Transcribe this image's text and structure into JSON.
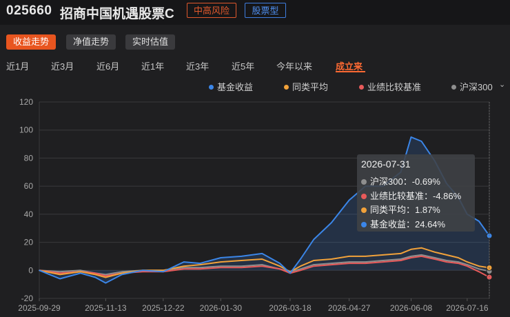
{
  "fund": {
    "code": "025660",
    "name": "招商中国机遇股票C",
    "risk_tag": "中高风险",
    "type_tag": "股票型"
  },
  "view_buttons": [
    "收益走势",
    "净值走势",
    "实时估值"
  ],
  "ranges": [
    "近1月",
    "近3月",
    "近6月",
    "近1年",
    "近3年",
    "近5年",
    "今年以来",
    "成立来"
  ],
  "active_range": "成立来",
  "colors": {
    "fund": "#3b86e8",
    "peer": "#f2a23a",
    "benchmark": "#e85a5a",
    "hs300": "#8e8e8e",
    "accent": "#e8551f"
  },
  "tooltip": {
    "date": "2026-07-31",
    "rows": [
      {
        "label": "沪深300：-0.69%",
        "series": "hs300"
      },
      {
        "label": "业绩比较基准：-4.86%",
        "series": "benchmark"
      },
      {
        "label": "同类平均：1.87%",
        "series": "peer"
      },
      {
        "label": "基金收益：24.64%",
        "series": "fund"
      }
    ]
  },
  "chart_data": {
    "type": "line",
    "ylim": [
      -20,
      120
    ],
    "y_ticks": [
      "120",
      "100",
      "80",
      "60",
      "40",
      "20",
      "0",
      "-20"
    ],
    "x_tick_labels": [
      "2025-09-29",
      "2025-11-13",
      "2025-12-22",
      "2026-01-30",
      "2026-03-18",
      "2026-04-27",
      "2026-06-08",
      "2026-07-16"
    ],
    "x": [
      "2025-09-29",
      "2025-10-13",
      "2025-10-27",
      "2025-11-06",
      "2025-11-13",
      "2025-11-24",
      "2025-12-08",
      "2025-12-22",
      "2026-01-05",
      "2026-01-16",
      "2026-01-30",
      "2026-02-13",
      "2026-02-27",
      "2026-03-11",
      "2026-03-18",
      "2026-03-25",
      "2026-04-03",
      "2026-04-15",
      "2026-04-27",
      "2026-05-08",
      "2026-05-20",
      "2026-06-01",
      "2026-06-08",
      "2026-06-15",
      "2026-06-24",
      "2026-07-02",
      "2026-07-10",
      "2026-07-16",
      "2026-07-24",
      "2026-07-31"
    ],
    "series": [
      {
        "name": "基金收益",
        "key": "fund",
        "values": [
          0,
          -6,
          -2,
          -5,
          -9,
          -3,
          0,
          -1,
          6,
          5,
          9,
          10,
          12,
          5,
          -2,
          8,
          22,
          34,
          50,
          60,
          60,
          70,
          95,
          92,
          78,
          62,
          52,
          40,
          35,
          24.64
        ]
      },
      {
        "name": "同类平均",
        "key": "peer",
        "values": [
          0,
          -3,
          -1,
          -3,
          -5,
          -2,
          0,
          0,
          3,
          4,
          6,
          7,
          8,
          3,
          -1,
          3,
          7,
          8,
          10,
          10,
          11,
          12,
          15,
          16,
          13,
          11,
          9,
          6,
          3,
          1.87
        ]
      },
      {
        "name": "业绩比较基准",
        "key": "benchmark",
        "values": [
          0,
          -2,
          -1,
          -2,
          -4,
          -2,
          -1,
          -1,
          1,
          1,
          2,
          2,
          3,
          1,
          -2,
          0,
          3,
          4,
          5,
          5,
          6,
          7,
          9,
          10,
          8,
          6,
          5,
          3,
          -1,
          -4.86
        ]
      },
      {
        "name": "沪深300",
        "key": "hs300",
        "values": [
          0,
          -1,
          0,
          -2,
          -3,
          -1,
          0,
          0,
          2,
          2,
          3,
          3,
          4,
          1,
          -1,
          1,
          4,
          5,
          6,
          6,
          7,
          8,
          10,
          11,
          9,
          7,
          6,
          4,
          1,
          -0.69
        ]
      }
    ]
  }
}
